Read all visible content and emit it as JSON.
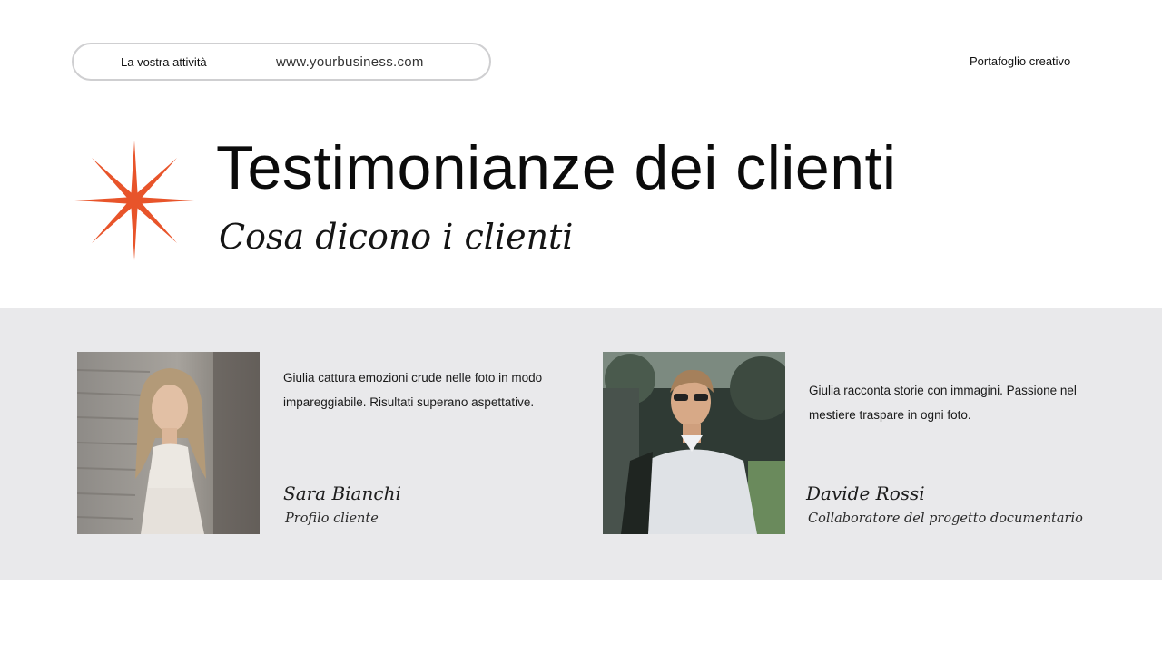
{
  "header": {
    "brand": "La vostra attività",
    "url": "www.yourbusiness.com",
    "section": "Portafoglio creativo"
  },
  "hero": {
    "title": "Testimonianze dei clienti",
    "subtitle": "Cosa dicono i clienti",
    "star_icon": "eight-point-star-icon"
  },
  "testimonials": [
    {
      "quote": "Giulia cattura emozioni crude nelle foto in modo impareggiabile. Risultati superano aspettative.",
      "name": "Sara Bianchi",
      "role": "Profilo cliente",
      "photo": "woman-portrait-photo"
    },
    {
      "quote": "Giulia racconta storie con immagini. Passione nel mestiere traspare in ogni foto.",
      "name": "Davide Rossi",
      "role": "Collaboratore del progetto documentario",
      "photo": "man-portrait-photo"
    }
  ],
  "colors": {
    "accent": "#e8542a",
    "band": "#e9e9eb",
    "pill_border": "#cfcfd1",
    "text": "#0b0b0b"
  }
}
